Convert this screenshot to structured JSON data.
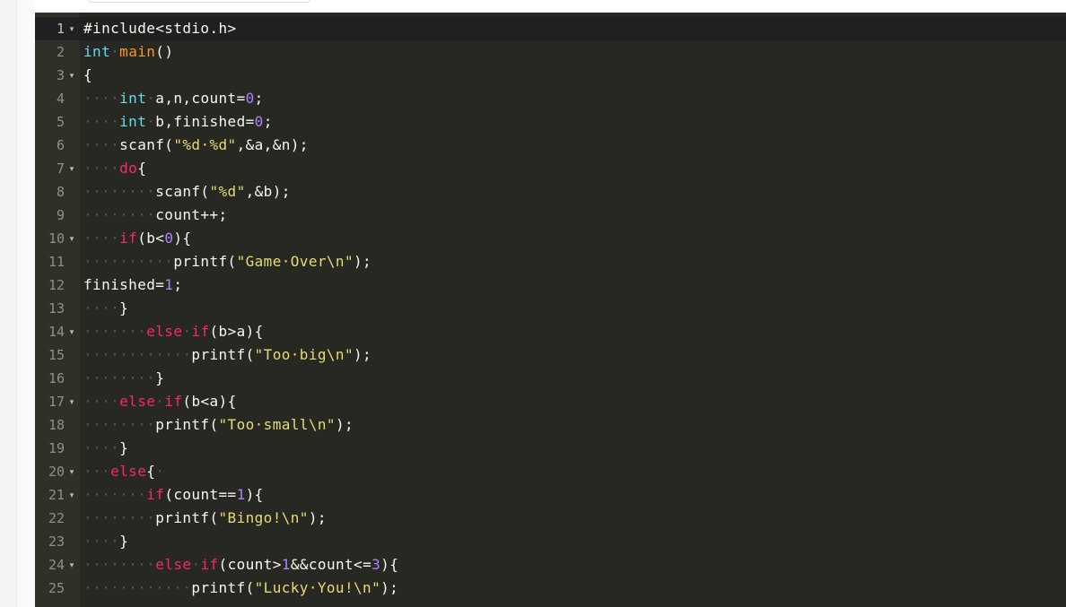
{
  "colors": {
    "background": "#272822",
    "gutter": "#2f3129",
    "active_line": "#202020",
    "plain": "#f8f8f2",
    "storage": "#66d9ef",
    "keyword": "#f92672",
    "function": "#fd971f",
    "string": "#e6db74",
    "number": "#ae81ff",
    "whitespace_marker": "#56574f"
  },
  "editor": {
    "fold_icon": "fold-arrow-icon",
    "fold_glyph": "▾",
    "lines": [
      {
        "n": "1",
        "fold": true,
        "active": true,
        "tokens": [
          {
            "t": "plain",
            "v": "#include<stdio.h>"
          }
        ]
      },
      {
        "n": "2",
        "fold": false,
        "tokens": [
          {
            "t": "storage",
            "v": "int"
          },
          {
            "t": "ws",
            "v": "·"
          },
          {
            "t": "function",
            "v": "main"
          },
          {
            "t": "plain",
            "v": "()"
          }
        ]
      },
      {
        "n": "3",
        "fold": true,
        "tokens": [
          {
            "t": "plain",
            "v": "{"
          }
        ]
      },
      {
        "n": "4",
        "fold": false,
        "tokens": [
          {
            "t": "ws",
            "v": "····"
          },
          {
            "t": "storage",
            "v": "int"
          },
          {
            "t": "ws",
            "v": "·"
          },
          {
            "t": "plain",
            "v": "a,n,count="
          },
          {
            "t": "number",
            "v": "0"
          },
          {
            "t": "plain",
            "v": ";"
          }
        ]
      },
      {
        "n": "5",
        "fold": false,
        "tokens": [
          {
            "t": "ws",
            "v": "····"
          },
          {
            "t": "storage",
            "v": "int"
          },
          {
            "t": "ws",
            "v": "·"
          },
          {
            "t": "plain",
            "v": "b,finished="
          },
          {
            "t": "number",
            "v": "0"
          },
          {
            "t": "plain",
            "v": ";"
          }
        ]
      },
      {
        "n": "6",
        "fold": false,
        "tokens": [
          {
            "t": "ws",
            "v": "····"
          },
          {
            "t": "plain",
            "v": "scanf("
          },
          {
            "t": "string",
            "v": "\"%d·%d\""
          },
          {
            "t": "plain",
            "v": ",&a,&n);"
          }
        ]
      },
      {
        "n": "7",
        "fold": true,
        "tokens": [
          {
            "t": "ws",
            "v": "····"
          },
          {
            "t": "keyword",
            "v": "do"
          },
          {
            "t": "plain",
            "v": "{"
          }
        ]
      },
      {
        "n": "8",
        "fold": false,
        "tokens": [
          {
            "t": "ws",
            "v": "········"
          },
          {
            "t": "plain",
            "v": "scanf("
          },
          {
            "t": "string",
            "v": "\"%d\""
          },
          {
            "t": "plain",
            "v": ",&b);"
          }
        ]
      },
      {
        "n": "9",
        "fold": false,
        "tokens": [
          {
            "t": "ws",
            "v": "········"
          },
          {
            "t": "plain",
            "v": "count++;"
          }
        ]
      },
      {
        "n": "10",
        "fold": true,
        "tokens": [
          {
            "t": "ws",
            "v": "····"
          },
          {
            "t": "keyword",
            "v": "if"
          },
          {
            "t": "plain",
            "v": "(b<"
          },
          {
            "t": "number",
            "v": "0"
          },
          {
            "t": "plain",
            "v": "){"
          }
        ]
      },
      {
        "n": "11",
        "fold": false,
        "tokens": [
          {
            "t": "ws",
            "v": "··········"
          },
          {
            "t": "plain",
            "v": "printf("
          },
          {
            "t": "string",
            "v": "\"Game·Over\\n\""
          },
          {
            "t": "plain",
            "v": ");"
          }
        ]
      },
      {
        "n": "12",
        "fold": false,
        "tokens": [
          {
            "t": "plain",
            "v": "finished="
          },
          {
            "t": "number",
            "v": "1"
          },
          {
            "t": "plain",
            "v": ";"
          }
        ]
      },
      {
        "n": "13",
        "fold": false,
        "tokens": [
          {
            "t": "ws",
            "v": "····"
          },
          {
            "t": "plain",
            "v": "}"
          }
        ]
      },
      {
        "n": "14",
        "fold": true,
        "tokens": [
          {
            "t": "ws",
            "v": "·······"
          },
          {
            "t": "keyword",
            "v": "else"
          },
          {
            "t": "ws",
            "v": "·"
          },
          {
            "t": "keyword",
            "v": "if"
          },
          {
            "t": "plain",
            "v": "(b>a){"
          }
        ]
      },
      {
        "n": "15",
        "fold": false,
        "tokens": [
          {
            "t": "ws",
            "v": "············"
          },
          {
            "t": "plain",
            "v": "printf("
          },
          {
            "t": "string",
            "v": "\"Too·big\\n\""
          },
          {
            "t": "plain",
            "v": ");"
          }
        ]
      },
      {
        "n": "16",
        "fold": false,
        "tokens": [
          {
            "t": "ws",
            "v": "········"
          },
          {
            "t": "plain",
            "v": "}"
          }
        ]
      },
      {
        "n": "17",
        "fold": true,
        "tokens": [
          {
            "t": "ws",
            "v": "····"
          },
          {
            "t": "keyword",
            "v": "else"
          },
          {
            "t": "ws",
            "v": "·"
          },
          {
            "t": "keyword",
            "v": "if"
          },
          {
            "t": "plain",
            "v": "(b<a){"
          }
        ]
      },
      {
        "n": "18",
        "fold": false,
        "tokens": [
          {
            "t": "ws",
            "v": "········"
          },
          {
            "t": "plain",
            "v": "printf("
          },
          {
            "t": "string",
            "v": "\"Too·small\\n\""
          },
          {
            "t": "plain",
            "v": ");"
          }
        ]
      },
      {
        "n": "19",
        "fold": false,
        "tokens": [
          {
            "t": "ws",
            "v": "····"
          },
          {
            "t": "plain",
            "v": "}"
          }
        ]
      },
      {
        "n": "20",
        "fold": true,
        "tokens": [
          {
            "t": "ws",
            "v": "···"
          },
          {
            "t": "keyword",
            "v": "else"
          },
          {
            "t": "plain",
            "v": "{"
          },
          {
            "t": "ws",
            "v": "·"
          }
        ]
      },
      {
        "n": "21",
        "fold": true,
        "tokens": [
          {
            "t": "ws",
            "v": "·······"
          },
          {
            "t": "keyword",
            "v": "if"
          },
          {
            "t": "plain",
            "v": "(count=="
          },
          {
            "t": "number",
            "v": "1"
          },
          {
            "t": "plain",
            "v": "){"
          }
        ]
      },
      {
        "n": "22",
        "fold": false,
        "tokens": [
          {
            "t": "ws",
            "v": "········"
          },
          {
            "t": "plain",
            "v": "printf("
          },
          {
            "t": "string",
            "v": "\"Bingo!\\n\""
          },
          {
            "t": "plain",
            "v": ");"
          }
        ]
      },
      {
        "n": "23",
        "fold": false,
        "tokens": [
          {
            "t": "ws",
            "v": "····"
          },
          {
            "t": "plain",
            "v": "}"
          }
        ]
      },
      {
        "n": "24",
        "fold": true,
        "tokens": [
          {
            "t": "ws",
            "v": "········"
          },
          {
            "t": "keyword",
            "v": "else"
          },
          {
            "t": "ws",
            "v": "·"
          },
          {
            "t": "keyword",
            "v": "if"
          },
          {
            "t": "plain",
            "v": "(count>"
          },
          {
            "t": "number",
            "v": "1"
          },
          {
            "t": "plain",
            "v": "&&count<="
          },
          {
            "t": "number",
            "v": "3"
          },
          {
            "t": "plain",
            "v": "){"
          }
        ]
      },
      {
        "n": "25",
        "fold": false,
        "tokens": [
          {
            "t": "ws",
            "v": "············"
          },
          {
            "t": "plain",
            "v": "printf("
          },
          {
            "t": "string",
            "v": "\"Lucky·You!\\n\""
          },
          {
            "t": "plain",
            "v": ");"
          }
        ]
      }
    ]
  }
}
